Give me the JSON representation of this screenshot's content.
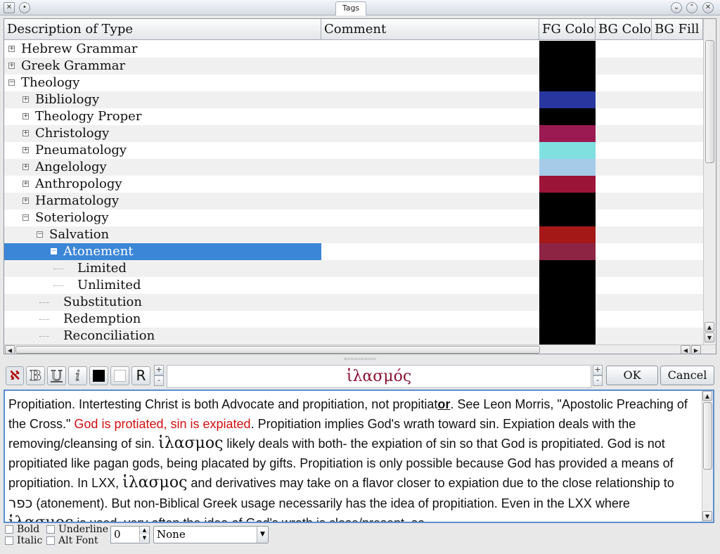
{
  "window": {
    "title": "Tags"
  },
  "columns": [
    "Description of Type",
    "Comment",
    "FG Color",
    "BG Color",
    "BG Fill"
  ],
  "tree": [
    {
      "label": "Hebrew Grammar",
      "level": 0,
      "expander": "+",
      "fg": "#000000",
      "alt": false,
      "selected": false
    },
    {
      "label": "Greek Grammar",
      "level": 0,
      "expander": "+",
      "fg": "#000000",
      "alt": true,
      "selected": false
    },
    {
      "label": "Theology",
      "level": 0,
      "expander": "-",
      "fg": "#000000",
      "alt": false,
      "selected": false
    },
    {
      "label": "Bibliology",
      "level": 1,
      "expander": "+",
      "fg": "#2a36a0",
      "alt": true,
      "selected": false
    },
    {
      "label": "Theology Proper",
      "level": 1,
      "expander": "+",
      "fg": "#000000",
      "alt": false,
      "selected": false
    },
    {
      "label": "Christology",
      "level": 1,
      "expander": "+",
      "fg": "#9c1a52",
      "alt": true,
      "selected": false
    },
    {
      "label": "Pneumatology",
      "level": 1,
      "expander": "+",
      "fg": "#80e0e0",
      "alt": false,
      "selected": false
    },
    {
      "label": "Angelology",
      "level": 1,
      "expander": "+",
      "fg": "#a6cbe8",
      "alt": true,
      "selected": false
    },
    {
      "label": "Anthropology",
      "level": 1,
      "expander": "+",
      "fg": "#9c1438",
      "alt": false,
      "selected": false
    },
    {
      "label": "Harmatology",
      "level": 1,
      "expander": "+",
      "fg": "#000000",
      "alt": true,
      "selected": false
    },
    {
      "label": "Soteriology",
      "level": 1,
      "expander": "-",
      "fg": "#000000",
      "alt": false,
      "selected": false
    },
    {
      "label": "Salvation",
      "level": 2,
      "expander": "-",
      "fg": "#a51818",
      "alt": true,
      "selected": false
    },
    {
      "label": "Atonement",
      "level": 3,
      "expander": "-",
      "fg": "#8e2444",
      "alt": false,
      "selected": true
    },
    {
      "label": "Limited",
      "level": 4,
      "expander": "",
      "fg": "#000000",
      "alt": true,
      "selected": false
    },
    {
      "label": "Unlimited",
      "level": 4,
      "expander": "",
      "fg": "#000000",
      "alt": false,
      "selected": false
    },
    {
      "label": "Substitution",
      "level": 3,
      "expander": "",
      "fg": "#000000",
      "alt": true,
      "selected": false
    },
    {
      "label": "Redemption",
      "level": 3,
      "expander": "",
      "fg": "#000000",
      "alt": false,
      "selected": false
    },
    {
      "label": "Reconciliation",
      "level": 3,
      "expander": "",
      "fg": "#000000",
      "alt": true,
      "selected": false
    }
  ],
  "toolbar": {
    "hebrew_label": "ℵ",
    "bold_label": "B",
    "underline_label": "U",
    "italic_label": "i",
    "reset_label": "R",
    "spin_up": "+",
    "spin_down": "-",
    "tag_name": "ἱλασμός",
    "ok_label": "OK",
    "cancel_label": "Cancel"
  },
  "editor": {
    "p1": "Propitiation. Intertesting Christ is both Advocate and propitiation, not propitiat",
    "p1_bold": "or",
    "p2": ". See Leon Morris, \"Apostolic Preaching of the Cross.\" ",
    "p_red": "God is protiated, sin is expiated",
    "p3": ". Propitiation implies God's wrath toward sin. Expiation deals with the removing/cleansing of sin. ",
    "greek1": "ἱλασμος",
    "p4": " likely deals with both- the expiation of sin so that God is propitiated. God is not propitiated like pagan gods, being placated by gifts. Propitiation is only possible because God has provided a means of propitiation. In LXX, ",
    "greek2": "ἱλασμος",
    "p5": " and derivatives may take on a flavor closer to expiation due to the close relationship to ",
    "hebrew": "כפר",
    "p6": " (atonement). But non-Biblical Greek usage necessarily has the idea of propitiation. Even in the LXX where ",
    "greek3": "ἱλασμος",
    "p7": " is used, very often the idea of God's wrath is close/present, so"
  },
  "options": {
    "bold_label": "Bold",
    "italic_label": "Italic",
    "underline_label": "Underline",
    "altfont_label": "Alt Font",
    "number_value": "0",
    "fill_value": "None"
  }
}
